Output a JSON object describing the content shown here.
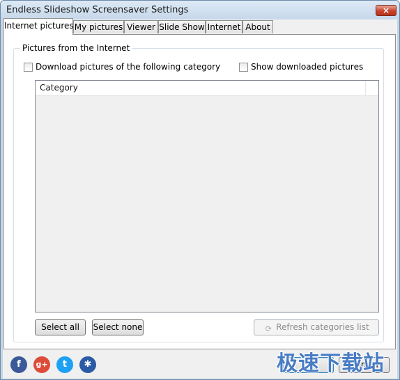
{
  "window": {
    "title": "Endless Slideshow Screensaver Settings",
    "close_glyph": "×"
  },
  "tabs": [
    {
      "label": "Internet pictures",
      "active": true
    },
    {
      "label": "My pictures",
      "active": false
    },
    {
      "label": "Viewer",
      "active": false
    },
    {
      "label": "Slide Show",
      "active": false
    },
    {
      "label": "Internet",
      "active": false
    },
    {
      "label": "About",
      "active": false
    }
  ],
  "internet_pictures": {
    "group_label": "Pictures from the Internet",
    "download_checkbox": {
      "label": "Download pictures of the following category",
      "checked": false
    },
    "show_downloaded_checkbox": {
      "label": "Show downloaded pictures",
      "checked": false
    },
    "category_list": {
      "column_header": "Category",
      "items": []
    },
    "select_all_label": "Select all",
    "select_none_label": "Select none",
    "refresh_label": "Refresh categories list"
  },
  "footer": {
    "social_icons": [
      {
        "icon": "facebook-icon",
        "glyph": "f",
        "color": "#3b5998"
      },
      {
        "icon": "google-plus-icon",
        "glyph": "g+",
        "color": "#dd4b39"
      },
      {
        "icon": "twitter-icon",
        "glyph": "t",
        "color": "#1da1f2"
      },
      {
        "icon": "myspace-icon",
        "glyph": "✱",
        "color": "#2c5ba6"
      }
    ],
    "ok_label": "OK",
    "cancel_label": "Cancel"
  },
  "watermark": "极速下载站"
}
